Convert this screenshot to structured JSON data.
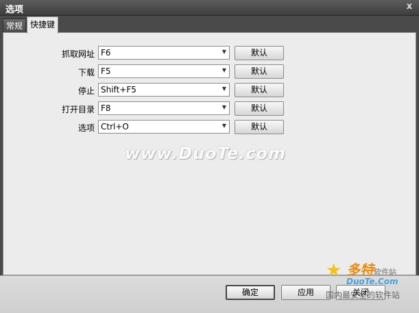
{
  "window": {
    "title": "选项",
    "close_glyph": "x"
  },
  "tabs": [
    {
      "label": "常规",
      "active": false
    },
    {
      "label": "快捷键",
      "active": true
    }
  ],
  "shortcuts": [
    {
      "label": "抓取网址",
      "value": "F6",
      "button": "默认"
    },
    {
      "label": "下载",
      "value": "F5",
      "button": "默认"
    },
    {
      "label": "停止",
      "value": "Shift+F5",
      "button": "默认"
    },
    {
      "label": "打开目录",
      "value": "F8",
      "button": "默认"
    },
    {
      "label": "选项",
      "value": "Ctrl+O",
      "button": "默认"
    }
  ],
  "watermark": "www.DuoTe.com",
  "footer": {
    "ok": "确定",
    "apply": "应用",
    "close": "关闭"
  },
  "logo": {
    "brand": "多特",
    "brand_suffix": "软件站",
    "domain": "DuoTe.Com",
    "slogan": "国内最安全的软件站"
  },
  "colors": {
    "titlebar": "#4a4a4a",
    "panel": "#ececec",
    "logo_orange": "#e88a10"
  }
}
